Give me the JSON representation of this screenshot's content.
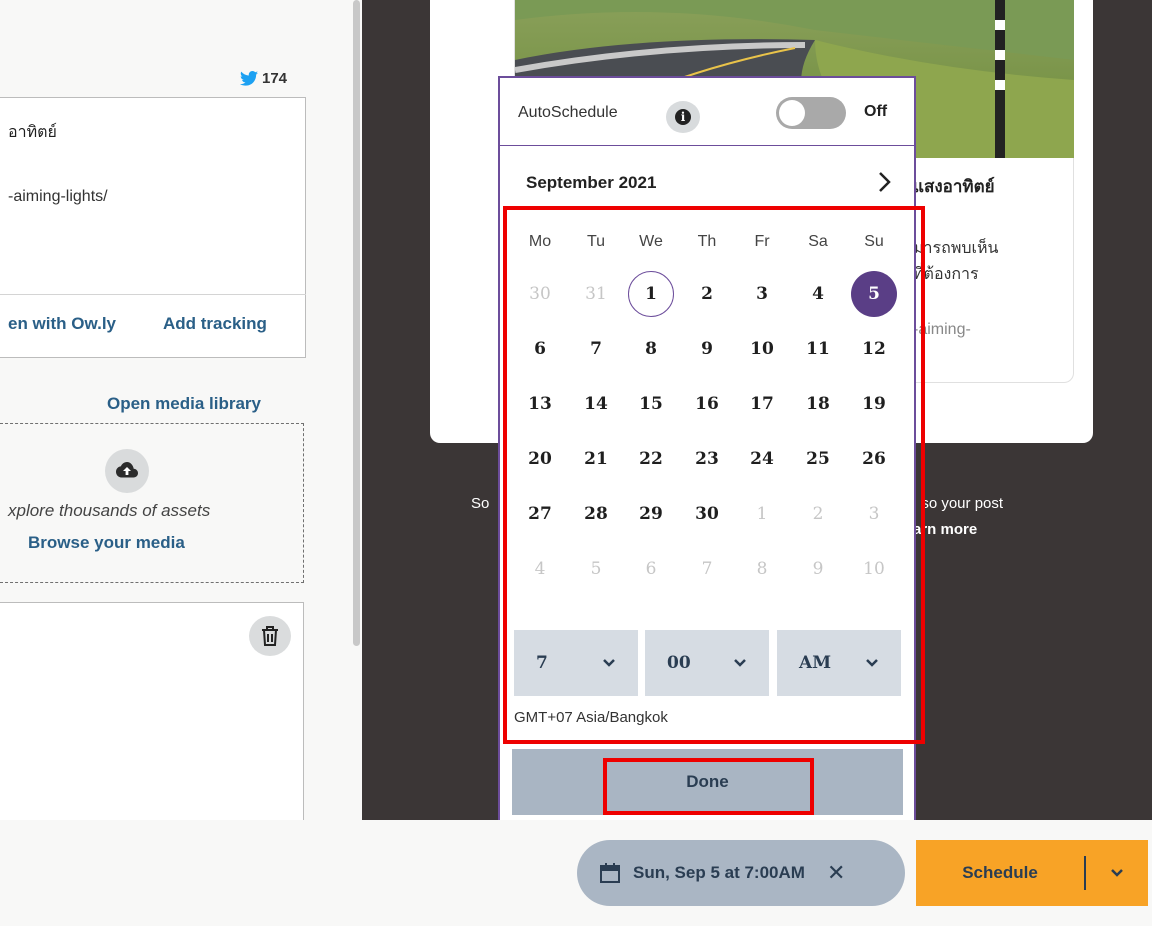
{
  "composer": {
    "tweet_count": "174",
    "message_line1": "อาทิตย์",
    "message_line2": "-aiming-lights/",
    "shorten_link": "en with Ow.ly",
    "tracking_link": "Add tracking",
    "media_library_link": "Open media library",
    "explore_text": "xplore thousands of assets",
    "browse_link": "Browse your media"
  },
  "preview": {
    "title": "แสงอาทิตย์",
    "desc_line1": "มารถพบเห็น",
    "desc_line2": "ที่ต้องการ",
    "url": "-aiming-",
    "note_left": "So",
    "note_right": ", so your post",
    "learn_more": "arn more"
  },
  "picker": {
    "autoschedule_label": "AutoSchedule",
    "toggle_state": "Off",
    "month": "September 2021",
    "weekdays": [
      "Mo",
      "Tu",
      "We",
      "Th",
      "Fr",
      "Sa",
      "Su"
    ],
    "weeks": [
      [
        "30",
        "31",
        "1",
        "2",
        "3",
        "4",
        "5"
      ],
      [
        "6",
        "7",
        "8",
        "9",
        "10",
        "11",
        "12"
      ],
      [
        "13",
        "14",
        "15",
        "16",
        "17",
        "18",
        "19"
      ],
      [
        "20",
        "21",
        "22",
        "23",
        "24",
        "25",
        "26"
      ],
      [
        "27",
        "28",
        "29",
        "30",
        "1",
        "2",
        "3"
      ],
      [
        "4",
        "5",
        "6",
        "7",
        "8",
        "9",
        "10"
      ]
    ],
    "hour": "7",
    "minute": "00",
    "meridiem": "AM",
    "timezone": "GMT+07 Asia/Bangkok",
    "done_label": "Done"
  },
  "bottom": {
    "scheduled_time": "Sun, Sep 5 at 7:00AM",
    "schedule_label": "Schedule"
  },
  "colors": {
    "accent_purple": "#5a3e86",
    "schedule_orange": "#f8a326",
    "link_blue": "#2a5f87",
    "highlight_red": "#ee0000"
  }
}
